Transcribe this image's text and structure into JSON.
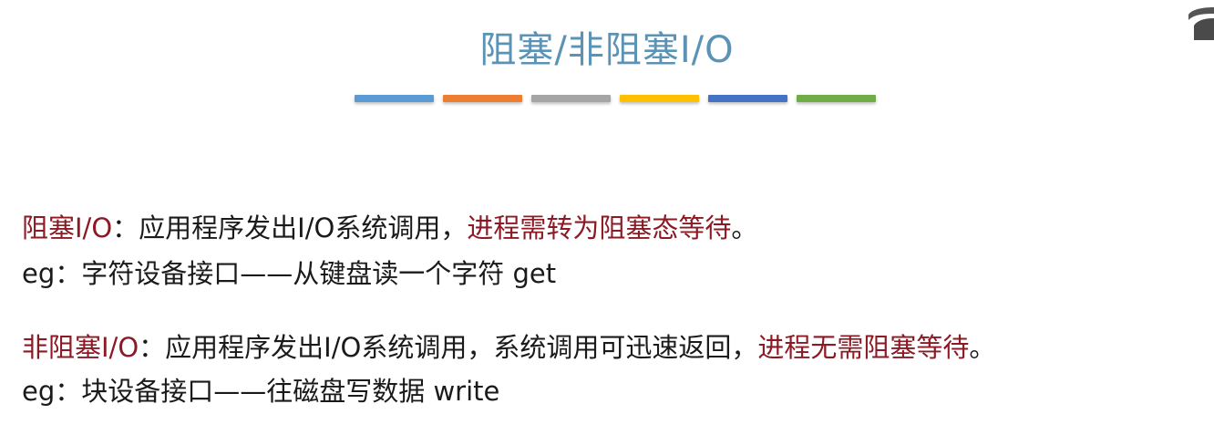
{
  "title": "阻塞/非阻塞I/O",
  "color_bars": [
    "#5b9bd5",
    "#ed7d31",
    "#a5a5a5",
    "#ffc000",
    "#4472c4",
    "#70ad47"
  ],
  "colors": {
    "accent_red": "#8b1a24",
    "title_blue": "#5b93b6"
  },
  "blocking": {
    "label": "阻塞I/O",
    "sep": "：",
    "text": "应用程序发出I/O系统调用，",
    "emphasis": "进程需转为阻塞态等待",
    "end": "。",
    "example": "eg：字符设备接口——从键盘读一个字符 get"
  },
  "nonblocking": {
    "label": "非阻塞I/O",
    "sep": "：",
    "text": "应用程序发出I/O系统调用，系统调用可迅速返回，",
    "emphasis": "进程无需阻塞等待",
    "end": "。",
    "example": "eg：块设备接口——往磁盘写数据 write"
  }
}
